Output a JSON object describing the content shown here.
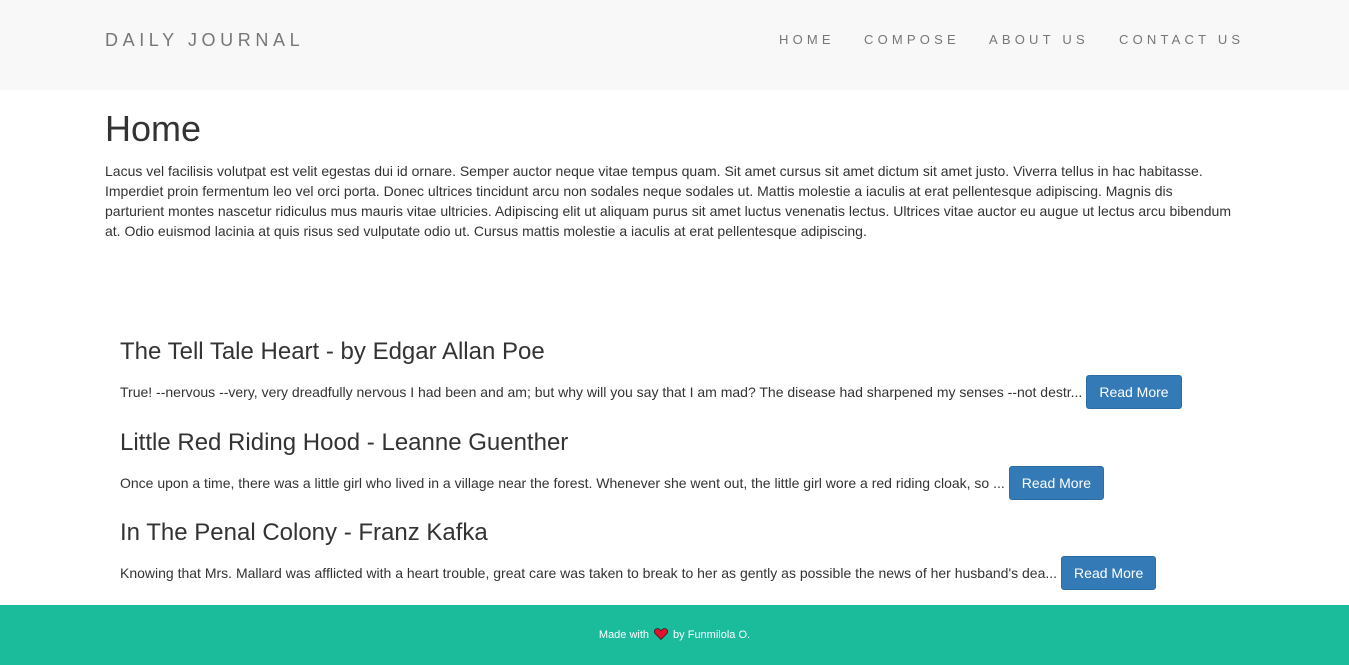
{
  "navbar": {
    "brand": "DAILY JOURNAL",
    "links": [
      {
        "label": "HOME"
      },
      {
        "label": "COMPOSE"
      },
      {
        "label": "ABOUT US"
      },
      {
        "label": "CONTACT US"
      }
    ]
  },
  "main": {
    "title": "Home",
    "intro": "Lacus vel facilisis volutpat est velit egestas dui id ornare. Semper auctor neque vitae tempus quam. Sit amet cursus sit amet dictum sit amet justo. Viverra tellus in hac habitasse. Imperdiet proin fermentum leo vel orci porta. Donec ultrices tincidunt arcu non sodales neque sodales ut. Mattis molestie a iaculis at erat pellentesque adipiscing. Magnis dis parturient montes nascetur ridiculus mus mauris vitae ultricies. Adipiscing elit ut aliquam purus sit amet luctus venenatis lectus. Ultrices vitae auctor eu augue ut lectus arcu bibendum at. Odio euismod lacinia at quis risus sed vulputate odio ut. Cursus mattis molestie a iaculis at erat pellentesque adipiscing."
  },
  "posts": [
    {
      "title": "The Tell Tale Heart - by Edgar Allan Poe",
      "excerpt": "True! --nervous --very, very dreadfully nervous I had been and am; but why will you say that I am mad? The disease had sharpened my senses --not destr...",
      "button": "Read More"
    },
    {
      "title": "Little Red Riding Hood - Leanne Guenther",
      "excerpt": "Once upon a time, there was a little girl who lived in a village near the forest. Whenever she went out, the little girl wore a red riding cloak, so ...",
      "button": "Read More"
    },
    {
      "title": "In The Penal Colony - Franz Kafka",
      "excerpt": "Knowing that Mrs. Mallard was afflicted with a heart trouble, great care was taken to break to her as gently as possible the news of her husband's dea...",
      "button": "Read More"
    }
  ],
  "footer": {
    "prefix": "Made with",
    "icon": "heart-icon",
    "suffix": "by Funmilola O."
  },
  "colors": {
    "navbar_bg": "#f8f8f8",
    "footer_bg": "#1abc9c",
    "button_bg": "#337ab7",
    "heart": "#e8112d"
  }
}
